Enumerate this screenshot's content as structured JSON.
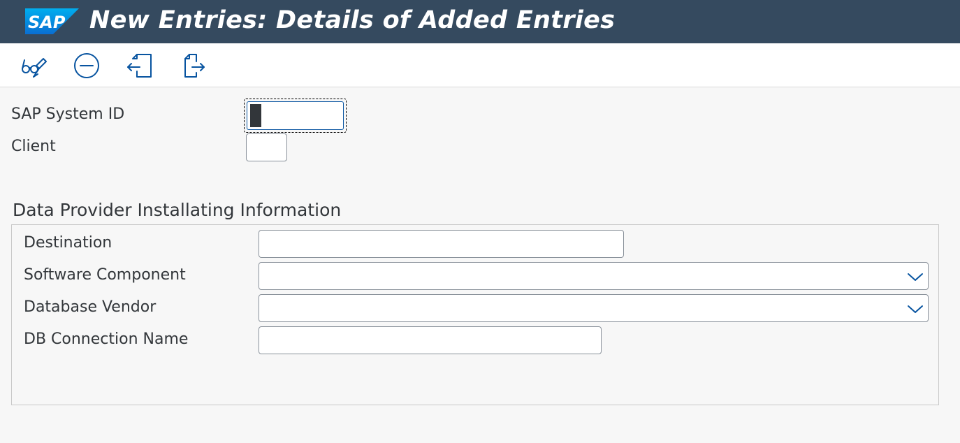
{
  "app": {
    "title": "New Entries: Details of Added Entries",
    "logo_text": "SAP",
    "colors": {
      "shell": "#354a5f",
      "brand": "#0a6ed1",
      "accent": "#0854a0",
      "icon": "#0854a0"
    }
  },
  "toolbar": {
    "buttons": [
      {
        "name": "display-change-icon"
      },
      {
        "name": "delete-icon"
      },
      {
        "name": "previous-entry-icon"
      },
      {
        "name": "next-entry-icon"
      }
    ]
  },
  "header_fields": {
    "system_id": {
      "label": "SAP System ID",
      "value": ""
    },
    "client": {
      "label": "Client",
      "value": ""
    }
  },
  "group": {
    "title": "Data Provider Installating Information",
    "destination": {
      "label": "Destination",
      "value": ""
    },
    "software_component": {
      "label": "Software Component",
      "value": ""
    },
    "database_vendor": {
      "label": "Database Vendor",
      "value": ""
    },
    "db_connection_name": {
      "label": "DB Connection Name",
      "value": ""
    }
  }
}
